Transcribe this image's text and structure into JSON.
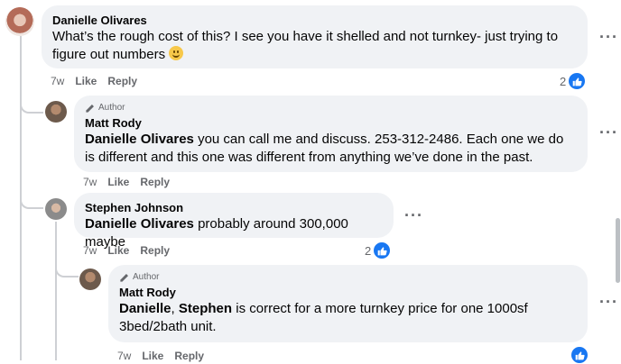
{
  "comments": [
    {
      "author": "Danielle Olivares",
      "text": "What’s the rough cost of this? I see you have it shelled and not turnkey- just trying to figure out numbers",
      "emoji": "smiling-face",
      "time": "7w",
      "like": "Like",
      "reply": "Reply",
      "reaction_count": "2"
    },
    {
      "badge": "Author",
      "author": "Matt Rody",
      "mention": "Danielle Olivares",
      "text": " you can call me and discuss. 253-312-2486. Each one we do is different and this one was different from anything we’ve done in the past.",
      "time": "7w",
      "like": "Like",
      "reply": "Reply"
    },
    {
      "author": "Stephen Johnson",
      "mention": "Danielle Olivares",
      "text": " probably around 300,000 maybe",
      "time": "7w",
      "like": "Like",
      "reply": "Reply",
      "reaction_count": "2"
    },
    {
      "badge": "Author",
      "author": "Matt Rody",
      "mention": "Danielle",
      "mention_sep": ", ",
      "mention2": "Stephen",
      "text": " is correct for a more turnkey price for one 1000sf 3bed/2bath unit.",
      "time": "7w",
      "like": "Like",
      "reply": "Reply"
    }
  ],
  "colors": {
    "bubble": "#f0f2f5",
    "like_blue": "#1877f2",
    "meta_gray": "#65676b"
  },
  "icons": {
    "badge": "pencil-icon",
    "reaction": "thumbs-up-icon",
    "menu": "more-options-icon"
  }
}
